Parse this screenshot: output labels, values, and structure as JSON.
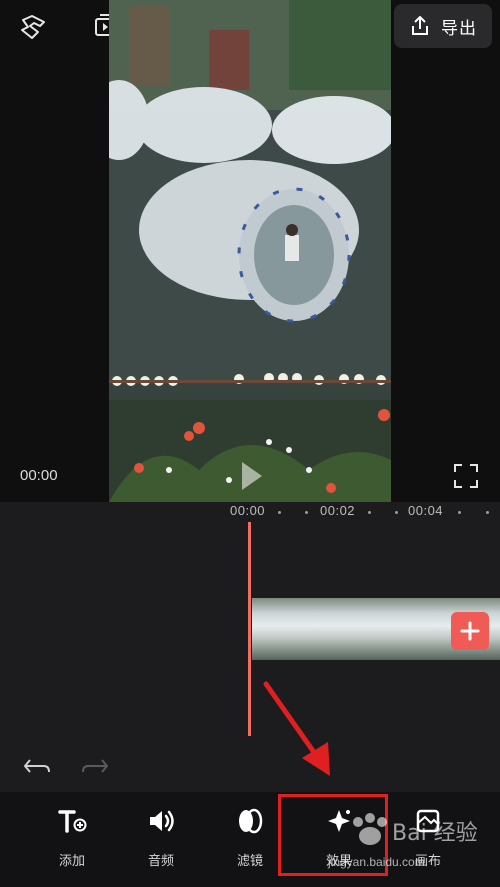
{
  "header": {
    "export_label": "导出"
  },
  "preview": {
    "current_time": "00:00"
  },
  "timeline": {
    "ruler": [
      "00:00",
      "00:02",
      "00:04"
    ]
  },
  "toolbar": {
    "items": [
      {
        "label": "添加",
        "icon": "text-add-icon"
      },
      {
        "label": "音频",
        "icon": "speaker-icon"
      },
      {
        "label": "滤镜",
        "icon": "filter-icon"
      },
      {
        "label": "效果",
        "icon": "effects-sparkle-icon"
      },
      {
        "label": "画布",
        "icon": "canvas-icon"
      }
    ]
  },
  "watermark": {
    "text": "jingyan.baidu.com",
    "brand": "Baidu经验"
  },
  "colors": {
    "accent": "#f26c5f",
    "add_button": "#f15b55",
    "annotation": "#e02020"
  }
}
